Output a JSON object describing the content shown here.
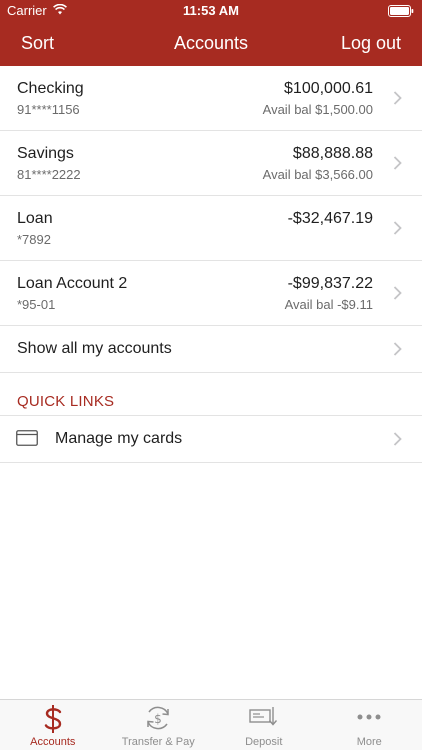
{
  "status_bar": {
    "carrier": "Carrier",
    "time": "11:53 AM"
  },
  "nav": {
    "sort_label": "Sort",
    "title": "Accounts",
    "logout_label": "Log out"
  },
  "accounts": [
    {
      "name": "Checking",
      "number": "91****1156",
      "balance": "$100,000.61",
      "avail": "Avail bal $1,500.00"
    },
    {
      "name": "Savings",
      "number": "81****2222",
      "balance": "$88,888.88",
      "avail": "Avail bal $3,566.00"
    },
    {
      "name": "Loan",
      "number": "*7892",
      "balance": "-$32,467.19",
      "avail": ""
    },
    {
      "name": "Loan Account 2",
      "number": "*95-01",
      "balance": "-$99,837.22",
      "avail": "Avail bal -$9.11"
    }
  ],
  "show_all_label": "Show all my accounts",
  "quick_links": {
    "header": "QUICK LINKS",
    "items": [
      {
        "label": "Manage my cards",
        "icon": "credit-card-icon"
      }
    ]
  },
  "tabs": [
    {
      "label": "Accounts",
      "icon": "dollar-icon",
      "active": true
    },
    {
      "label": "Transfer & Pay",
      "icon": "transfer-pay-icon",
      "active": false
    },
    {
      "label": "Deposit",
      "icon": "deposit-check-icon",
      "active": false
    },
    {
      "label": "More",
      "icon": "more-dots-icon",
      "active": false
    }
  ],
  "colors": {
    "brand": "#a72b21",
    "text": "#1f1f1f",
    "secondary_text": "#6b6b6b",
    "inactive_tab": "#8e8e8e"
  }
}
